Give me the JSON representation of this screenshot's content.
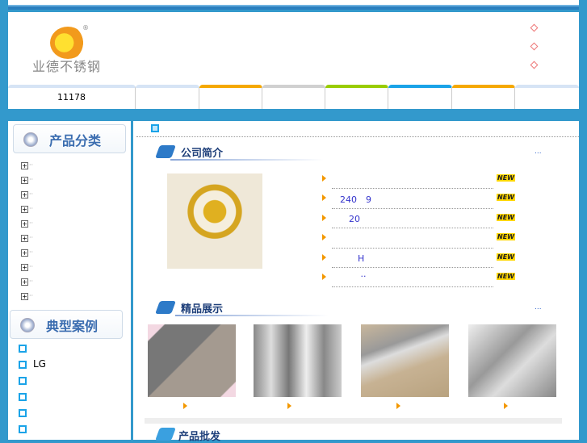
{
  "header": {
    "logo_text": "业德不锈钢",
    "registered": "®"
  },
  "nav": {
    "tabs": [
      "11178",
      "",
      "",
      "",
      "",
      "",
      "",
      ""
    ],
    "colors": [
      "#d6e4f5",
      "#d6e4f5",
      "#f5a800",
      "#d0d0d0",
      "#99cc00",
      "#1aa3e8",
      "#f5a800",
      "#d6e4f5"
    ]
  },
  "sidebar": {
    "category_title": "产品分类",
    "category_items": [
      "",
      "",
      "",
      "",
      "",
      "",
      "",
      "",
      "",
      ""
    ],
    "cases_title": "典型案例",
    "cases": [
      "",
      "LG",
      "",
      "",
      "",
      ""
    ]
  },
  "main": {
    "about": {
      "title": "公司简介",
      "more": "..."
    },
    "news": [
      {
        "text": ""
      },
      {
        "text": "240　9"
      },
      {
        "text": "　20"
      },
      {
        "text": ""
      },
      {
        "text": "　　H"
      },
      {
        "text": "　　 ··"
      }
    ],
    "new_badge": "NEW",
    "showcase": {
      "title": "精品展示",
      "more": "...",
      "items": [
        "",
        "",
        "",
        ""
      ]
    },
    "wholesale": {
      "title": "产品批发"
    }
  }
}
